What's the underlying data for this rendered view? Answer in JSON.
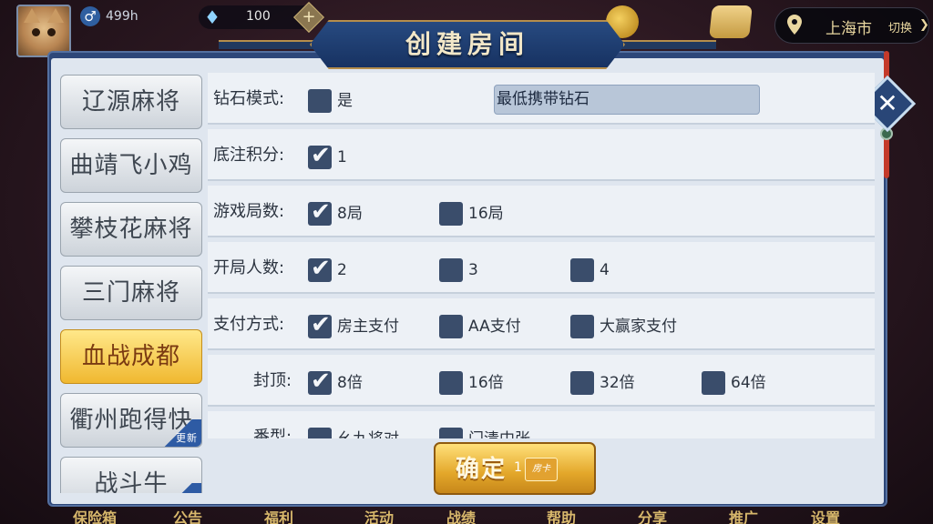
{
  "topbar": {
    "score": "499h",
    "diamonds": "100",
    "city": "上海市",
    "switch_label": "切换"
  },
  "dialog": {
    "title": "创建房间",
    "confirm_label": "确定",
    "confirm_count": "1",
    "room_card_label": "房卡"
  },
  "games": [
    {
      "label": "辽源麻将",
      "active": false,
      "new": false
    },
    {
      "label": "曲靖飞小鸡",
      "active": false,
      "new": false
    },
    {
      "label": "攀枝花麻将",
      "active": false,
      "new": false
    },
    {
      "label": "三门麻将",
      "active": false,
      "new": false
    },
    {
      "label": "血战成都",
      "active": true,
      "new": false
    },
    {
      "label": "衢州跑得快",
      "active": false,
      "new": true,
      "tag": "更新"
    },
    {
      "label": "战斗牛",
      "active": false,
      "new": true,
      "tag": ""
    }
  ],
  "rows": [
    {
      "label": "钻石模式:",
      "options": [
        {
          "text": "是",
          "checked": false
        }
      ],
      "field": "最低携带钻石"
    },
    {
      "label": "底注积分:",
      "options": [
        {
          "text": "1",
          "checked": true
        }
      ]
    },
    {
      "label": "游戏局数:",
      "options": [
        {
          "text": "8局",
          "checked": true
        },
        {
          "text": "16局",
          "checked": false
        }
      ]
    },
    {
      "label": "开局人数:",
      "options": [
        {
          "text": "2",
          "checked": true
        },
        {
          "text": "3",
          "checked": false
        },
        {
          "text": "4",
          "checked": false
        }
      ]
    },
    {
      "label": "支付方式:",
      "options": [
        {
          "text": "房主支付",
          "checked": true
        },
        {
          "text": "AA支付",
          "checked": false
        },
        {
          "text": "大赢家支付",
          "checked": false
        }
      ]
    },
    {
      "label": "封顶:",
      "options": [
        {
          "text": "8倍",
          "checked": true
        },
        {
          "text": "16倍",
          "checked": false
        },
        {
          "text": "32倍",
          "checked": false
        },
        {
          "text": "64倍",
          "checked": false
        }
      ]
    },
    {
      "label": "番型:",
      "options": [
        {
          "text": "幺九将对",
          "checked": false
        },
        {
          "text": "门清中张",
          "checked": false
        }
      ]
    }
  ],
  "bottom_menu": [
    "保险箱",
    "公告",
    "福利",
    "活动",
    "战绩",
    "帮助",
    "分享",
    "推广",
    "设置"
  ]
}
